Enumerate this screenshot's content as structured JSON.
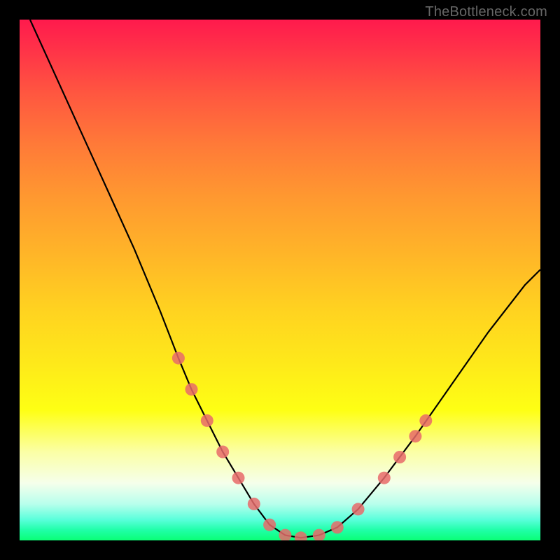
{
  "watermark": "TheBottleneck.com",
  "chart_data": {
    "type": "line",
    "title": "",
    "xlabel": "",
    "ylabel": "",
    "xlim": [
      0,
      100
    ],
    "ylim": [
      0,
      100
    ],
    "series": [
      {
        "name": "bottleneck-curve",
        "x": [
          2,
          7,
          12,
          17,
          22,
          27,
          30.5,
          33,
          36,
          39,
          42,
          45,
          48,
          51,
          54,
          57.5,
          61,
          65,
          70,
          76,
          83,
          90,
          97,
          100
        ],
        "y": [
          100,
          89,
          78,
          67,
          56,
          44,
          35,
          29,
          23,
          17,
          12,
          7,
          3,
          1,
          0.5,
          1,
          2.5,
          6,
          12,
          20,
          30,
          40,
          49,
          52
        ]
      }
    ],
    "markers": [
      {
        "name": "left-cluster",
        "points": [
          {
            "x": 30.5,
            "y": 35
          },
          {
            "x": 33,
            "y": 29
          },
          {
            "x": 36,
            "y": 23
          },
          {
            "x": 39,
            "y": 17
          },
          {
            "x": 42,
            "y": 12
          },
          {
            "x": 45,
            "y": 7
          },
          {
            "x": 48,
            "y": 3
          },
          {
            "x": 51,
            "y": 1
          }
        ]
      },
      {
        "name": "right-cluster",
        "points": [
          {
            "x": 54,
            "y": 0.5
          },
          {
            "x": 57.5,
            "y": 1
          },
          {
            "x": 61,
            "y": 2.5
          },
          {
            "x": 65,
            "y": 6
          },
          {
            "x": 70,
            "y": 12
          },
          {
            "x": 73,
            "y": 16
          },
          {
            "x": 76,
            "y": 20
          },
          {
            "x": 78,
            "y": 23
          }
        ]
      }
    ]
  }
}
